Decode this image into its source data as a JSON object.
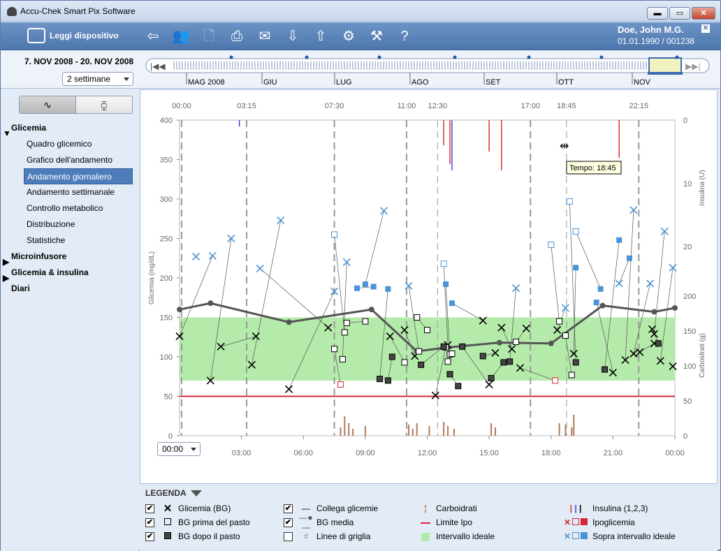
{
  "app": {
    "title": "Accu-Chek Smart Pix Software"
  },
  "toolbar": {
    "read_device_label": "Leggi dispositivo",
    "icons": [
      "back-icon",
      "patients-icon",
      "new-doc-icon",
      "print-icon",
      "email-icon",
      "download-icon",
      "upload-icon",
      "settings-icon",
      "tools-icon",
      "help-icon"
    ]
  },
  "patient": {
    "name": "Doe, John M.G.",
    "dob_id": "01.01.1990 / 001238"
  },
  "date_range": {
    "label": "7. NOV 2008 - 20. NOV 2008",
    "period_value": "2 settimane"
  },
  "timeline": {
    "months": [
      "MAG 2008",
      "GIU",
      "LUG",
      "AGO",
      "SET",
      "OTT",
      "NOV"
    ]
  },
  "sidebar": {
    "groups": [
      {
        "label": "Glicemia",
        "expanded": true,
        "items": [
          "Quadro glicemico",
          "Grafico dell'andamento",
          "Andamento giornaliero",
          "Andamento settimanale",
          "Controllo metabolico",
          "Distribuzione",
          "Statistiche"
        ],
        "active": "Andamento giornaliero"
      },
      {
        "label": "Microinfusore",
        "expanded": false
      },
      {
        "label": "Glicemia & insulina",
        "expanded": false
      },
      {
        "label": "Diari",
        "expanded": null
      }
    ]
  },
  "chart": {
    "top_markers": [
      "00:00",
      "03:15",
      "07:30",
      "11:00",
      "12:30",
      "17:00",
      "18:45",
      "22:15"
    ],
    "tooltip": "Tempo: 18:45",
    "start_time_value": "00:00"
  },
  "chart_data": {
    "type": "scatter",
    "xlabel": "",
    "ylabel": "Glicemia (mg/dL)",
    "ylim": [
      0,
      400
    ],
    "yticks": [
      0,
      50,
      100,
      150,
      200,
      250,
      300,
      350,
      400
    ],
    "xticks": [
      "03:00",
      "06:00",
      "09:00",
      "12:00",
      "15:00",
      "18:00",
      "21:00",
      "00:00"
    ],
    "right_axis_insulin": {
      "label": "Insulina (U)",
      "ticks": [
        "0",
        "10",
        "20"
      ]
    },
    "right_axis_carbs": {
      "label": "Carboidrati (g)",
      "ticks": [
        "200",
        "150",
        "100",
        "50",
        "0"
      ]
    },
    "target_range": [
      70,
      150
    ],
    "hypo_limit": 50,
    "colors": {
      "target": "#b4eaaa",
      "hypo": "#d6283a",
      "avg": "#555555",
      "above": "#4a94d6",
      "carbs": "#b07a58"
    },
    "bg_avg": {
      "x": [
        0,
        1.5,
        5.3,
        9.3,
        11.5,
        13,
        15.5,
        18,
        20.5,
        23,
        24
      ],
      "y": [
        160,
        168,
        144,
        160,
        107,
        112,
        118,
        117,
        165,
        157,
        162
      ]
    },
    "bg": {
      "x": [
        0,
        1.5,
        2.0,
        3.5,
        3.7,
        5.3,
        7.2,
        10.2,
        10.9,
        11.4,
        12.4,
        13.0,
        14.7,
        15.0,
        15.3,
        15.6,
        16.1,
        16.5,
        16.8,
        18.3,
        19.1,
        21.0,
        21.6,
        22.0,
        22.3,
        22.9,
        23.0,
        23.3,
        23.0,
        23.9
      ],
      "y": [
        126,
        70,
        113,
        90,
        126,
        59,
        137,
        126,
        134,
        101,
        51,
        115,
        146,
        65,
        105,
        137,
        110,
        86,
        136,
        134,
        104,
        80,
        96,
        104,
        106,
        135,
        117,
        95,
        129,
        88
      ]
    },
    "bg_before": {
      "x": [
        7.5,
        7.9,
        7.8,
        8.0,
        8.1,
        9.0,
        10.9,
        11.5,
        11.6,
        12.0,
        12.9,
        13.0,
        13.1,
        13.2,
        16.3,
        18.2,
        18.4,
        18.7,
        19.0
      ],
      "y": [
        110,
        97,
        65,
        131,
        143,
        145,
        93,
        150,
        107,
        134,
        112,
        94,
        103,
        104,
        119,
        70,
        145,
        127,
        77
      ]
    },
    "bg_after": {
      "x": [
        9.7,
        10.1,
        10.3,
        11.7,
        12.8,
        13.1,
        13.5,
        13.7,
        14.7,
        15.1,
        15.7,
        16.0,
        19.2,
        20.6,
        23.2
      ],
      "y": [
        72,
        70,
        100,
        90,
        113,
        78,
        63,
        113,
        101,
        73,
        93,
        94,
        93,
        84,
        117
      ]
    },
    "above_x": {
      "x": [
        0.8,
        1.6,
        2.5,
        3.9,
        4.9,
        7.5,
        8.1,
        9.9,
        11.1,
        16.3,
        18.7,
        21.3,
        22.0,
        22.8,
        23.5,
        23.9
      ],
      "y": [
        227,
        228,
        250,
        212,
        273,
        183,
        220,
        285,
        190,
        187,
        162,
        193,
        286,
        193,
        259,
        213
      ]
    },
    "above_box": {
      "x": [
        7.5,
        12.8,
        18.0,
        18.9,
        19.2
      ],
      "y": [
        255,
        218,
        242,
        297,
        259
      ]
    },
    "above_fill": {
      "x": [
        8.6,
        9.0,
        9.4,
        10.1,
        12.9,
        13.2,
        19.2,
        20.2,
        20.4,
        21.3,
        21.8
      ],
      "y": [
        187,
        192,
        189,
        186,
        192,
        168,
        213,
        169,
        186,
        248,
        225
      ]
    },
    "carbs": {
      "x": [
        7.8,
        8.0,
        8.2,
        8.4,
        9.0,
        11.1,
        11.3,
        11.5,
        12.1,
        12.8,
        13.0,
        13.3,
        15.1,
        15.3,
        18.4,
        18.7,
        19.0,
        19.1
      ],
      "y": [
        12,
        28,
        18,
        10,
        14,
        16,
        10,
        18,
        14,
        20,
        14,
        10,
        18,
        12,
        18,
        16,
        12,
        30
      ]
    },
    "insulin": {
      "x": [
        2.9,
        12.8,
        13.1,
        13.2,
        15.0,
        15.6,
        21.3
      ],
      "y": [
        1,
        4,
        7,
        8,
        5,
        8,
        6
      ],
      "colors": [
        "#3344dd",
        "#e03030",
        "#e03030",
        "#4444ee",
        "#e03030",
        "#e03030",
        "#e03030"
      ]
    }
  },
  "legend": {
    "title": "LEGENDA",
    "items": [
      {
        "label": "Glicemia (BG)",
        "checked": true
      },
      {
        "label": "BG prima del pasto",
        "checked": true
      },
      {
        "label": "BG dopo il pasto",
        "checked": true
      },
      {
        "label": "Collega glicemie",
        "checked": true
      },
      {
        "label": "BG media",
        "checked": true
      },
      {
        "label": "Linee di griglia",
        "checked": false
      },
      {
        "label": "Carboidrati"
      },
      {
        "label": "Limite Ipo"
      },
      {
        "label": "Intervallo ideale"
      },
      {
        "label": "Insulina (1,2,3)"
      },
      {
        "label": "Ipoglicemia"
      },
      {
        "label": "Sopra intervallo ideale"
      }
    ]
  }
}
